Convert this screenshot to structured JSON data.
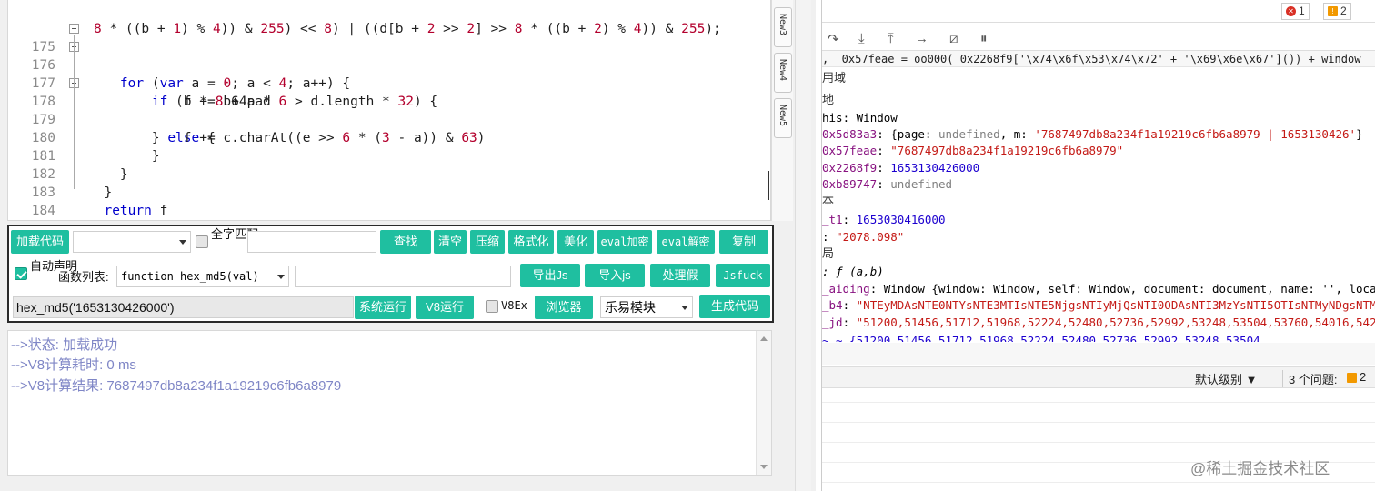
{
  "editor": {
    "lines": [
      {
        "n": "",
        "text": "8 * ((b + 1) % 4)) & 255) << 8) | ((d[b + 2 >> 2] >> 8 * ((b + 2) % 4)) & 255);"
      },
      {
        "n": "175",
        "text": "    for (var a = 0; a < 4; a++) {"
      },
      {
        "n": "176",
        "text": "        if (b * 8 + a * 6 > d.length * 32) {"
      },
      {
        "n": "177",
        "text": "            f += b64pad"
      },
      {
        "n": "178",
        "text": "        } else {"
      },
      {
        "n": "179",
        "text": "            f += c.charAt((e >> 6 * (3 - a)) & 63)"
      },
      {
        "n": "180",
        "text": "        }"
      },
      {
        "n": "181",
        "text": "    }"
      },
      {
        "n": "182",
        "text": "  }"
      },
      {
        "n": "183",
        "text": "  return f"
      },
      {
        "n": "184",
        "text": "};"
      }
    ],
    "tabs": [
      "New3",
      "New4",
      "New5"
    ]
  },
  "toolbar": {
    "load_code": "加载代码",
    "full_match": "全字匹配",
    "find": "查找",
    "clear": "清空",
    "compress": "压缩",
    "format": "格式化",
    "beautify": "美化",
    "eval_encrypt": "eval加密",
    "eval_decrypt": "eval解密",
    "copy": "复制",
    "auto_declare": "自动声明",
    "func_list_label": "函数列表:",
    "func_selected": "function hex_md5(val)",
    "export_js": "导出Js",
    "import_js": "导入js",
    "process_fake": "处理假",
    "jsfuck": "Jsfuck",
    "call_input": "hex_md5('1653130426000')",
    "sys_run": "系统运行",
    "v8_run": "V8运行",
    "v8ex": "V8Ex",
    "browser": "浏览器",
    "module_select": "乐易模块",
    "gen_code": "生成代码"
  },
  "console": {
    "lines": [
      "-->状态: 加载成功",
      "-->V8计算耗时: 0 ms",
      "-->V8计算结果: 7687497db8a234f1a19219c6fb6a8979"
    ]
  },
  "devtools": {
    "errors": "1",
    "warnings": "2",
    "watch_expr": ", _0x57feae = oo000(_0x2268f9['\\x74\\x6f\\x53\\x74\\x72' + '\\x69\\x6e\\x67']()) + window",
    "scope_label": "用域",
    "local_label": "地",
    "this_key": "his",
    "this_val": "Window",
    "v1_key": "0x5d83a3",
    "v1_val_pre": "{page: ",
    "v1_undef": "undefined",
    "v1_mid": ", m: ",
    "v1_str": "'7687497db8a234f1a19219c6fb6a8979 | 1653130426'",
    "v1_end": "}",
    "v2_key": "0x57feae",
    "v2_val": "\"7687497db8a234f1a19219c6fb6a8979\"",
    "v3_key": "0x2268f9",
    "v3_val": "1653130426000",
    "v4_key": "0xb89747",
    "v4_val": "undefined",
    "closure_label": "本",
    "t1_key": "_t1",
    "t1_val": "1653030416000",
    "str2_val": "\"2078.098\"",
    "global_label": "局",
    "fn_val": "ƒ (a,b)",
    "aiding_key": "_aiding",
    "aiding_val": "Window {window: Window, self: Window, document: document, name: '', locati",
    "b4_key": "_b4",
    "b4_val": "\"NTEyMDAsNTE0NTYsNTE3MTIsNTE5NjgsNTIyMjQsNTI0ODAsNTI3MzYsNTI5OTIsNTMyNDgsNTM1",
    "jd_key": "_jd",
    "jd_val": "\"51200,51456,51712,51968,52224,52480,52736,52992,53248,53504,53760,54016,5427",
    "cutoff_row": "~  ~  {51200  51456  51712  51968  52224  52480  52736  52992  53248  53504",
    "level_select": "默认级别 ▼",
    "issues": "3 个问题:",
    "issues_count": "2",
    "watermark": "@稀土掘金技术社区"
  }
}
